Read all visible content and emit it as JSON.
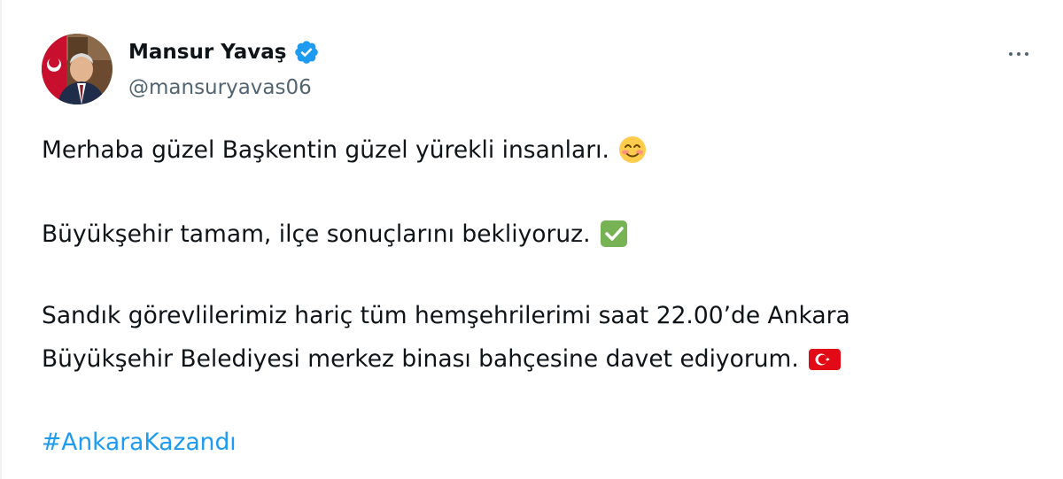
{
  "author": {
    "display_name": "Mansur Yavaş",
    "handle": "@mansuryavas06",
    "verified": true,
    "verified_icon": "verified-badge-icon",
    "verified_color": "#1d9bf0"
  },
  "menu": {
    "more_icon": "more-options-icon"
  },
  "tweet": {
    "line1": "Merhaba güzel Başkentin güzel yürekli insanları.",
    "line1_emoji": "smiling-face-icon",
    "line2": "Büyükşehir tamam, ilçe sonuçlarını bekliyoruz.",
    "line2_emoji": "check-mark-button-icon",
    "line3": "Sandık görevlilerimiz hariç tüm hemşehrilerimi saat 22.00’de Ankara",
    "line4": "Büyükşehir Belediyesi merkez binası bahçesine davet ediyorum.",
    "line4_emoji": "turkey-flag-icon",
    "hashtag": "#AnkaraKazandı",
    "hashtag_color": "#1d9bf0"
  }
}
